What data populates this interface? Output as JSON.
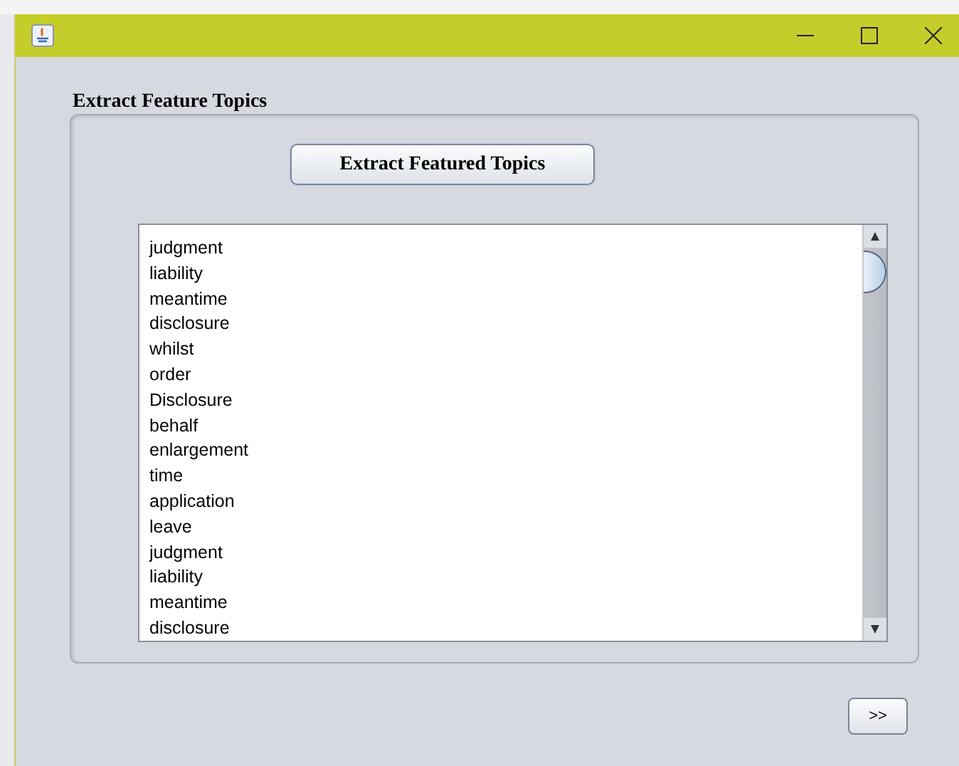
{
  "heading": "Extract Feature Topics",
  "extract_button": "Extract Featured Topics",
  "topics": [
    "judgment",
    "liability",
    "meantime",
    "disclosure",
    "whilst",
    "order",
    "Disclosure",
    "behalf",
    "enlargement",
    "time",
    "application",
    "leave",
    "judgment",
    "liability",
    "meantime",
    "disclosure"
  ],
  "next_button": ">>"
}
